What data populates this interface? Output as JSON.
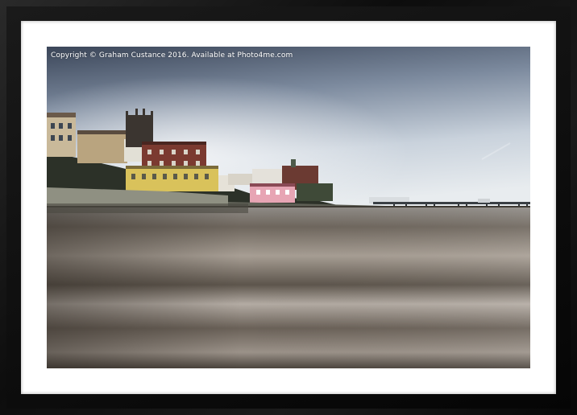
{
  "watermark": {
    "text": "Copyright  © Graham Custance  2016. Available at Photo4me.com"
  },
  "colors": {
    "frame": "#111111",
    "mount": "#ffffff",
    "sky_top": "#3f4a5e",
    "sky_horizon": "#e6ebef",
    "sand": "#5a534b"
  }
}
